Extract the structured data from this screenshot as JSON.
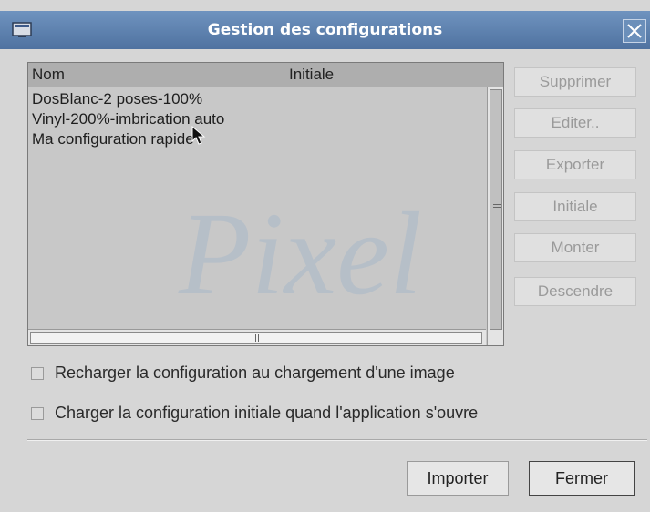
{
  "window": {
    "title": "Gestion des configurations"
  },
  "list": {
    "columns": [
      "Nom",
      "Initiale"
    ],
    "rows": [
      "DosBlanc-2 poses-100%",
      "Vinyl-200%-imbrication auto",
      "Ma configuration rapide"
    ]
  },
  "side_buttons": {
    "supprimer": "Supprimer",
    "editer": "Editer..",
    "exporter": "Exporter",
    "initiale": "Initiale",
    "monter": "Monter",
    "descendre": "Descendre"
  },
  "options": {
    "reload_label": "Recharger la configuration au chargement d'une image",
    "load_initial_label": "Charger la configuration initiale quand l'application s'ouvre"
  },
  "bottom_buttons": {
    "importer": "Importer",
    "fermer": "Fermer"
  },
  "watermark": "Pixel",
  "colors": {
    "titlebar": "#5b7fad",
    "window_bg": "#d6d6d6"
  }
}
